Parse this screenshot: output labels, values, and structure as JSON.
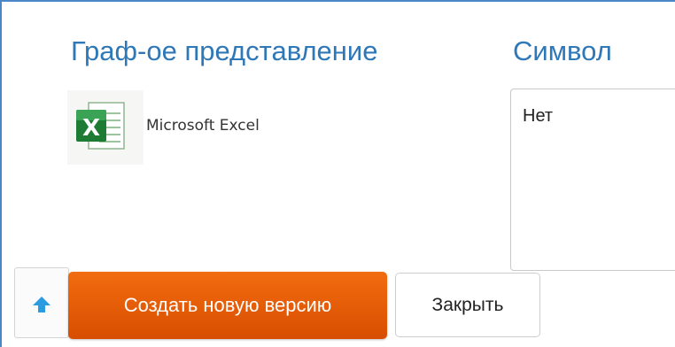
{
  "columns": {
    "graph_label": "Граф-ое представление",
    "symbol_label": "Символ"
  },
  "row": {
    "app_icon": "microsoft-excel-icon",
    "app_name": "Microsoft Excel",
    "symbol_value": "Нет"
  },
  "actions": {
    "scroll_up_icon": "arrow-up-icon",
    "create_label": "Создать новую версию",
    "close_label": "Закрыть"
  },
  "colors": {
    "accent": "#2f78b8",
    "primary_button": "#e85c06",
    "border": "#4a86c8"
  }
}
